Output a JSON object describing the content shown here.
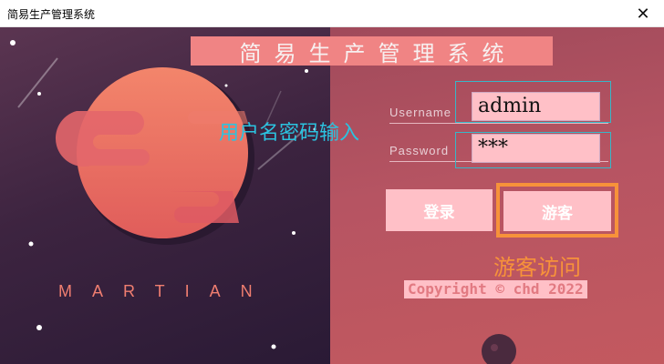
{
  "window": {
    "title": "简易生产管理系统",
    "close_glyph": "✕"
  },
  "app": {
    "title": "简易生产管理系统"
  },
  "brand": {
    "text": "MARTIAN"
  },
  "form": {
    "username_label": "Username",
    "username_value": "admin",
    "password_label": "Password",
    "password_value": "***"
  },
  "annotations": {
    "input_note": "用户名密码输入",
    "guest_note": "游客访问"
  },
  "buttons": {
    "login_label": "登录",
    "guest_label": "游客"
  },
  "footer": {
    "copyright": "Copyright © chd 2022"
  },
  "colors": {
    "accent_cyan": "#2bc3e0",
    "accent_orange": "#f7923a",
    "button_pink": "#ffc0c7",
    "title_band": "#f08484"
  }
}
